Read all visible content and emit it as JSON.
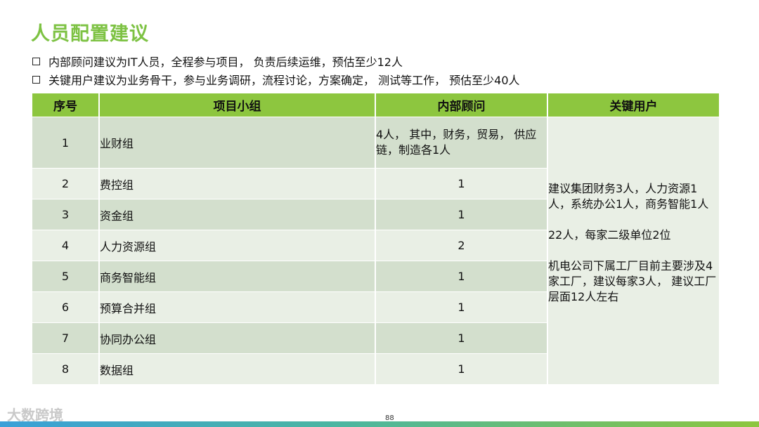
{
  "title": "人员配置建议",
  "bullets": [
    "内部顾问建议为IT人员，全程参与项目， 负责后续运维，预估至少12人",
    "关键用户建议为业务骨干，参与业务调研，流程讨论，方案确定， 测试等工作， 预估至少40人"
  ],
  "table": {
    "headers": [
      "序号",
      "项目小组",
      "内部顾问",
      "关键用户"
    ],
    "rows": [
      {
        "idx": "1",
        "group": "业财组",
        "advisor": "4人， 其中，财务，贸易， 供应链，制造各1人"
      },
      {
        "idx": "2",
        "group": "费控组",
        "advisor": "1"
      },
      {
        "idx": "3",
        "group": "资金组",
        "advisor": "1"
      },
      {
        "idx": "4",
        "group": "人力资源组",
        "advisor": "2"
      },
      {
        "idx": "5",
        "group": "商务智能组",
        "advisor": "1"
      },
      {
        "idx": "6",
        "group": "预算合并组",
        "advisor": "1"
      },
      {
        "idx": "7",
        "group": "协同办公组",
        "advisor": "1"
      },
      {
        "idx": "8",
        "group": "数据组",
        "advisor": "1"
      }
    ],
    "key_user": [
      "建议集团财务3人，人力资源1人，系统办公1人，商务智能1人",
      "22人，每家二级单位2位",
      "机电公司下属工厂目前主要涉及4家工厂，建议每家3人， 建议工厂层面12人左右"
    ]
  },
  "footer": {
    "logo_text": "大数跨境",
    "page_number": "88"
  },
  "colors": {
    "accent": "#7dc243",
    "header_bg": "#8dc63f",
    "row_dark": "#d3dfcd",
    "row_light": "#e9efe5"
  }
}
